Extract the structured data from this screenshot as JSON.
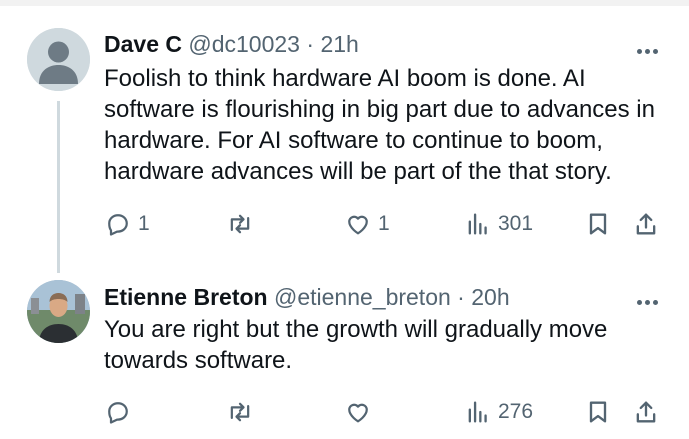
{
  "tweets": [
    {
      "name": "Dave C",
      "handle": "@dc10023",
      "sep": "·",
      "time": "21h",
      "text": "Foolish to think hardware AI boom is done. AI software is flourishing in big part due to advances in hardware. For AI software to continue to boom, hardware advances will be part of the that story.",
      "replies": "1",
      "reposts": "",
      "likes": "1",
      "views": "301"
    },
    {
      "name": "Etienne Breton",
      "handle": "@etienne_breton",
      "sep": "·",
      "time": "20h",
      "text": "You are right but the growth will gradually move towards software.",
      "replies": "",
      "reposts": "",
      "likes": "",
      "views": "276"
    }
  ],
  "icons": [
    "more-icon",
    "reply-icon",
    "repost-icon",
    "like-icon",
    "views-icon",
    "bookmark-icon",
    "share-icon"
  ],
  "colors": {
    "text": "#0f1419",
    "muted": "#536471",
    "thread_line": "#cfd9de"
  }
}
